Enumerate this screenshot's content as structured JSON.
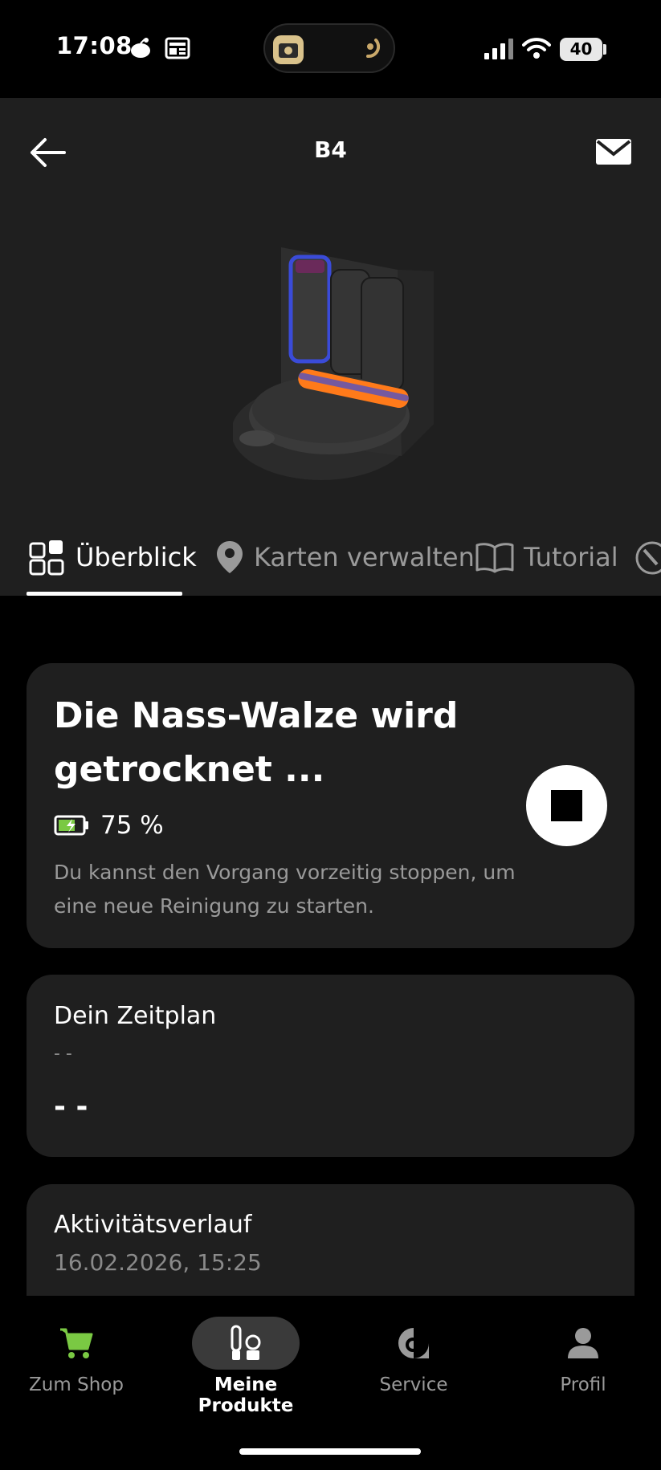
{
  "status_bar": {
    "time": "17:08",
    "battery": "40"
  },
  "header": {
    "title": "B4"
  },
  "tabs": [
    {
      "label": "Überblick",
      "icon": "grid-icon",
      "active": true
    },
    {
      "label": "Karten verwalten",
      "icon": "map-pin-icon",
      "active": false
    },
    {
      "label": "Tutorial",
      "icon": "book-icon",
      "active": false
    }
  ],
  "status_card": {
    "title": "Die Nass-Walze wird getrocknet ...",
    "battery_percent": "75 %",
    "battery_level": 0.75,
    "description": "Du kannst den Vorgang vorzeitig stoppen, um eine neue Reinigung zu starten."
  },
  "schedule_card": {
    "title": "Dein Zeitplan",
    "subtitle": "- -",
    "value": "- -"
  },
  "activity_card": {
    "title": "Aktivitätsverlauf",
    "timestamp": "16.02.2026, 15:25"
  },
  "bottom_nav": [
    {
      "label": "Zum Shop",
      "icon": "cart-icon"
    },
    {
      "label": "Meine Produkte",
      "icon": "products-icon",
      "active": true
    },
    {
      "label": "Service",
      "icon": "service-icon"
    },
    {
      "label": "Profil",
      "icon": "user-icon"
    }
  ],
  "colors": {
    "accent_green": "#7ac943",
    "card_bg": "#1f1f1f",
    "header_bg": "#1f1f1f",
    "robot_orange": "#ff7a1a",
    "robot_blue": "#3a4bd8"
  }
}
